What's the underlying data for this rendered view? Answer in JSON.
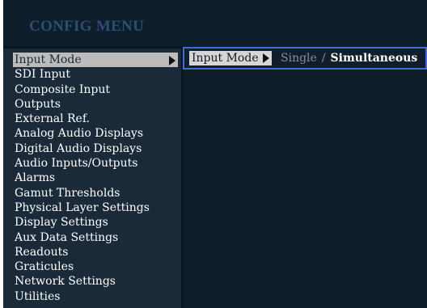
{
  "header": {
    "title": "CONFIG MENU"
  },
  "menu": {
    "items": [
      {
        "label": "Input Mode",
        "selected": true
      },
      {
        "label": "SDI Input"
      },
      {
        "label": "Composite Input"
      },
      {
        "label": "Outputs"
      },
      {
        "label": "External Ref."
      },
      {
        "label": "Analog Audio Displays"
      },
      {
        "label": "Digital Audio Displays"
      },
      {
        "label": "Audio Inputs/Outputs"
      },
      {
        "label": "Alarms"
      },
      {
        "label": "Gamut Thresholds"
      },
      {
        "label": "Physical Layer Settings"
      },
      {
        "label": "Display Settings"
      },
      {
        "label": "Aux Data Settings"
      },
      {
        "label": "Readouts"
      },
      {
        "label": "Graticules"
      },
      {
        "label": "Network Settings"
      },
      {
        "label": "Utilities"
      }
    ]
  },
  "submenu": {
    "label": "Input Mode",
    "option_single": "Single",
    "separator": "/",
    "option_simultaneous": "Simultaneous",
    "selected_option": "Simultaneous"
  },
  "colors": {
    "background": "#0f1e2b",
    "title": "#2d4d73",
    "selection": "#bcbcbc",
    "focus_border": "#3d6ed1",
    "inactive_option": "#8a8f95"
  }
}
